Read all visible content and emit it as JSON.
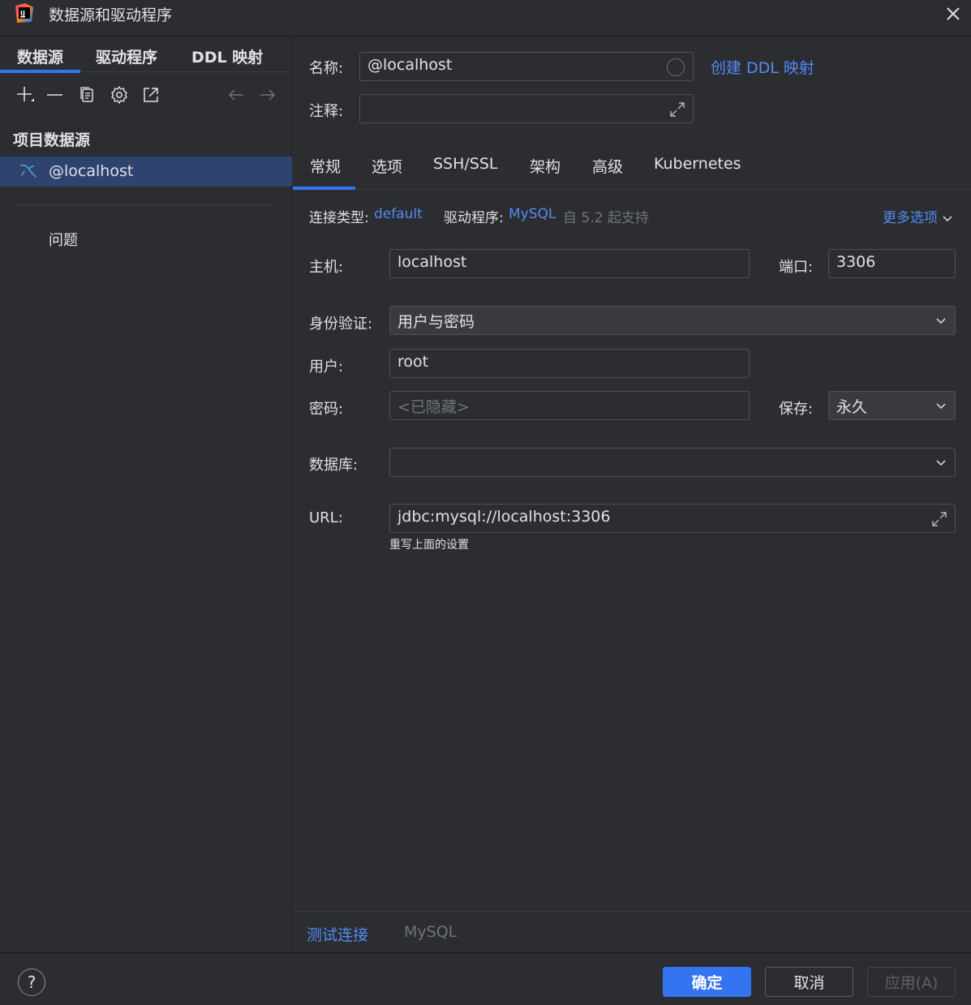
{
  "window": {
    "title": "数据源和驱动程序"
  },
  "left_panel": {
    "tabs": [
      "数据源",
      "驱动程序",
      "DDL 映射"
    ],
    "section_title": "项目数据源",
    "datasource": "@localhost",
    "problems": "问题"
  },
  "name_row": {
    "label": "名称:",
    "value": "@localhost",
    "create_ddl_link": "创建 DDL 映射"
  },
  "comment_row": {
    "label": "注释:",
    "value": ""
  },
  "tabs": [
    "常规",
    "选项",
    "SSH/SSL",
    "架构",
    "高级",
    "Kubernetes"
  ],
  "general": {
    "connection_type_label": "连接类型:",
    "connection_type_value": "default",
    "driver_label": "驱动程序:",
    "driver_value": "MySQL",
    "driver_note": "自 5.2 起支持",
    "more_options": "更多选项",
    "host_label": "主机:",
    "host_value": "localhost",
    "port_label": "端口:",
    "port_value": "3306",
    "auth_label": "身份验证:",
    "auth_value": "用户与密码",
    "user_label": "用户:",
    "user_value": "root",
    "password_label": "密码:",
    "password_placeholder": "<已隐藏>",
    "save_label": "保存:",
    "save_value": "永久",
    "database_label": "数据库:",
    "database_value": "",
    "url_label": "URL:",
    "url_value": "jdbc:mysql://localhost:3306",
    "url_note": "重写上面的设置"
  },
  "footer": {
    "test_connection": "测试连接",
    "driver_name": "MySQL"
  },
  "buttons": {
    "ok": "确定",
    "cancel": "取消",
    "apply": "应用(A)",
    "help": "?"
  },
  "colors": {
    "accent": "#3574f0",
    "link": "#548af7",
    "background": "#2b2d30",
    "selection": "#2e436e"
  }
}
